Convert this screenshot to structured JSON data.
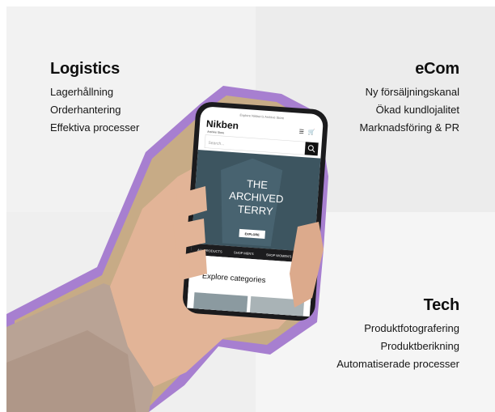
{
  "logistics": {
    "title": "Logistics",
    "items": [
      "Lagerhållning",
      "Orderhantering",
      "Effektiva processer"
    ]
  },
  "ecom": {
    "title": "eCom",
    "items": [
      "Ny försäljningskanal",
      "Ökad kundlojalitet",
      "Marknadsföring & PR"
    ]
  },
  "tech": {
    "title": "Tech",
    "items": [
      "Produktfotografering",
      "Produktberikning",
      "Automatiserade processer"
    ]
  },
  "phone": {
    "banner": "Explore Nikben's Archive Store",
    "logo": "Nikben",
    "logo_sub": "Archive Store",
    "search_placeholder": "Search...",
    "hero_line1": "THE",
    "hero_line2": "ARCHIVED",
    "hero_line3": "TERRY",
    "explore_label": "EXPLORE",
    "nav": [
      "ALL PRODUCTS",
      "SHOP MEN'S",
      "SHOP WOMEN'S"
    ],
    "categories_heading": "Explore categories"
  },
  "colors": {
    "outline": "#a77fd0",
    "phone_body": "#1b1b1d",
    "hero": "#3d5560",
    "skin": "#e2b497",
    "sleeve": "#b9a395"
  }
}
